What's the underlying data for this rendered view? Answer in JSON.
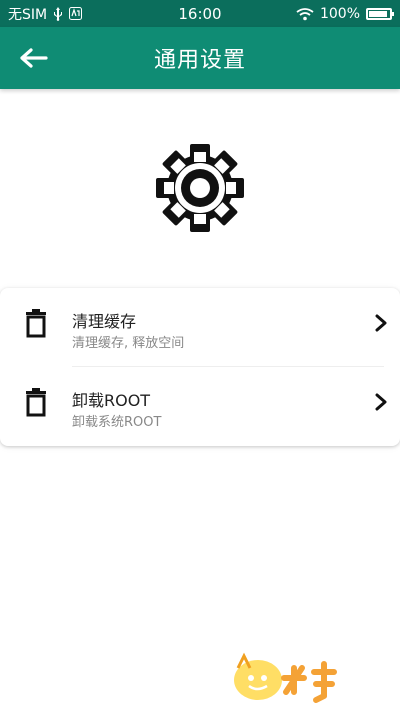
{
  "status_bar": {
    "carrier": "无SIM",
    "time": "16:00",
    "battery_text": "100%",
    "battery_level": 1.0,
    "icons": [
      "usb-icon",
      "nfc-badge-icon",
      "wifi-icon",
      "battery-icon"
    ]
  },
  "app_bar": {
    "title": "通用设置",
    "back_icon": "arrow-left-icon",
    "color": "#0f8c74",
    "status_color": "#0b6e5c"
  },
  "header_icon": "gear-icon",
  "settings": [
    {
      "icon": "trash-icon",
      "title": "清理缓存",
      "subtitle": "清理缓存, 释放空间"
    },
    {
      "icon": "trash-icon",
      "title": "卸载ROOT",
      "subtitle": "卸载系统ROOT"
    }
  ],
  "watermark": {
    "logo": "mascot-logo",
    "text": "水手"
  }
}
